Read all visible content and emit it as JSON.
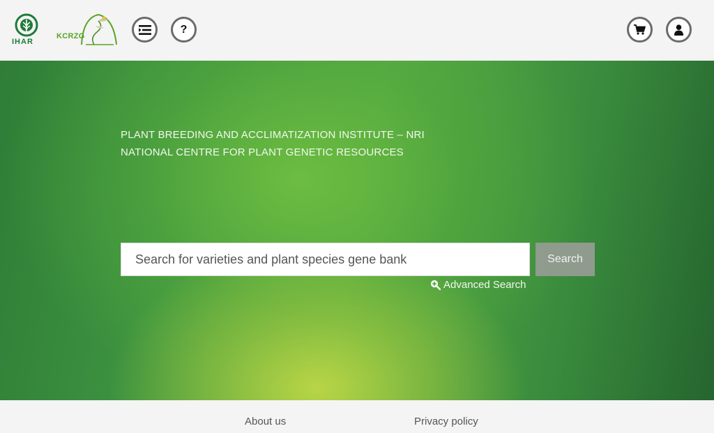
{
  "header": {
    "logo_ihar": {
      "text": "IHAR",
      "color": "#1f7a3a"
    },
    "logo_kcrzg": {
      "text": "KCRZG",
      "color": "#5aa526"
    },
    "menu_icon": "menu-list-icon",
    "help_icon": "question-icon",
    "help_glyph": "?",
    "cart_icon": "cart-icon",
    "user_icon": "user-icon"
  },
  "hero": {
    "line1": "PLANT BREEDING AND ACCLIMATIZATION INSTITUTE – NRI",
    "line2": "NATIONAL CENTRE FOR PLANT GENETIC RESOURCES",
    "search": {
      "placeholder": "Search for varieties and plant species gene bank",
      "value": "",
      "button_label": "Search"
    },
    "advanced_search": {
      "icon": "zoom-in-icon",
      "label": "Advanced Search"
    }
  },
  "footer": {
    "about": "About us",
    "privacy": "Privacy policy"
  },
  "colors": {
    "header_bg": "#f4f4f4",
    "hero_green": "#3d9340",
    "hero_light": "#b5d347",
    "search_button_bg": "#8f9b8c",
    "icon_border": "#6b6b6b"
  }
}
